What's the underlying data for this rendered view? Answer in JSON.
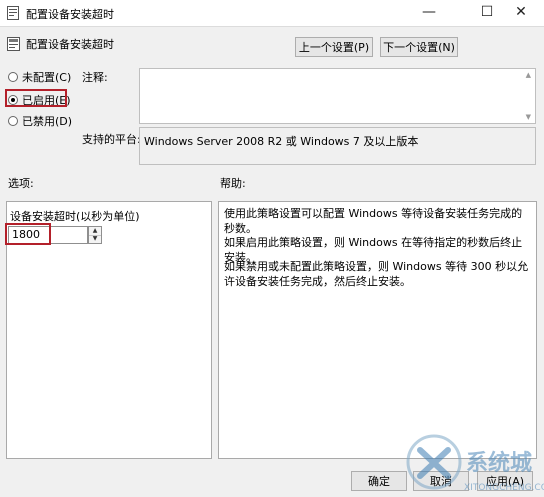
{
  "window": {
    "title": "配置设备安装超时",
    "controls": {
      "minimize": "—",
      "maximize": "☐",
      "close": "✕"
    }
  },
  "header": {
    "title": "配置设备安装超时",
    "prev_label": "上一个设置(P)",
    "next_label": "下一个设置(N)"
  },
  "state": {
    "options": [
      {
        "label": "未配置(C)",
        "checked": false
      },
      {
        "label": "已启用(E)",
        "checked": true
      },
      {
        "label": "已禁用(D)",
        "checked": false
      }
    ]
  },
  "comment": {
    "label": "注释:",
    "value": ""
  },
  "platform": {
    "label": "支持的平台:",
    "value": "Windows Server 2008 R2 或 Windows 7 及以上版本"
  },
  "options_section": {
    "label": "选项:",
    "timeout_label": "设备安装超时(以秒为单位)",
    "timeout_value": "1800"
  },
  "help_section": {
    "label": "帮助:",
    "paragraphs": [
      "使用此策略设置可以配置 Windows 等待设备安装任务完成的秒数。",
      "如果启用此策略设置，则 Windows 在等待指定的秒数后终止安装。",
      "如果禁用或未配置此策略设置，则 Windows 等待 300 秒以允许设备安装任务完成，然后终止安装。"
    ]
  },
  "footer": {
    "ok_label": "确定",
    "cancel_label": "取消",
    "apply_label": "应用(A)"
  },
  "watermark": {
    "text": "系统城",
    "url": "XITONGCHENG.COM"
  },
  "colors": {
    "highlight": "#b3202a",
    "window_bg": "#f0f0f0"
  }
}
